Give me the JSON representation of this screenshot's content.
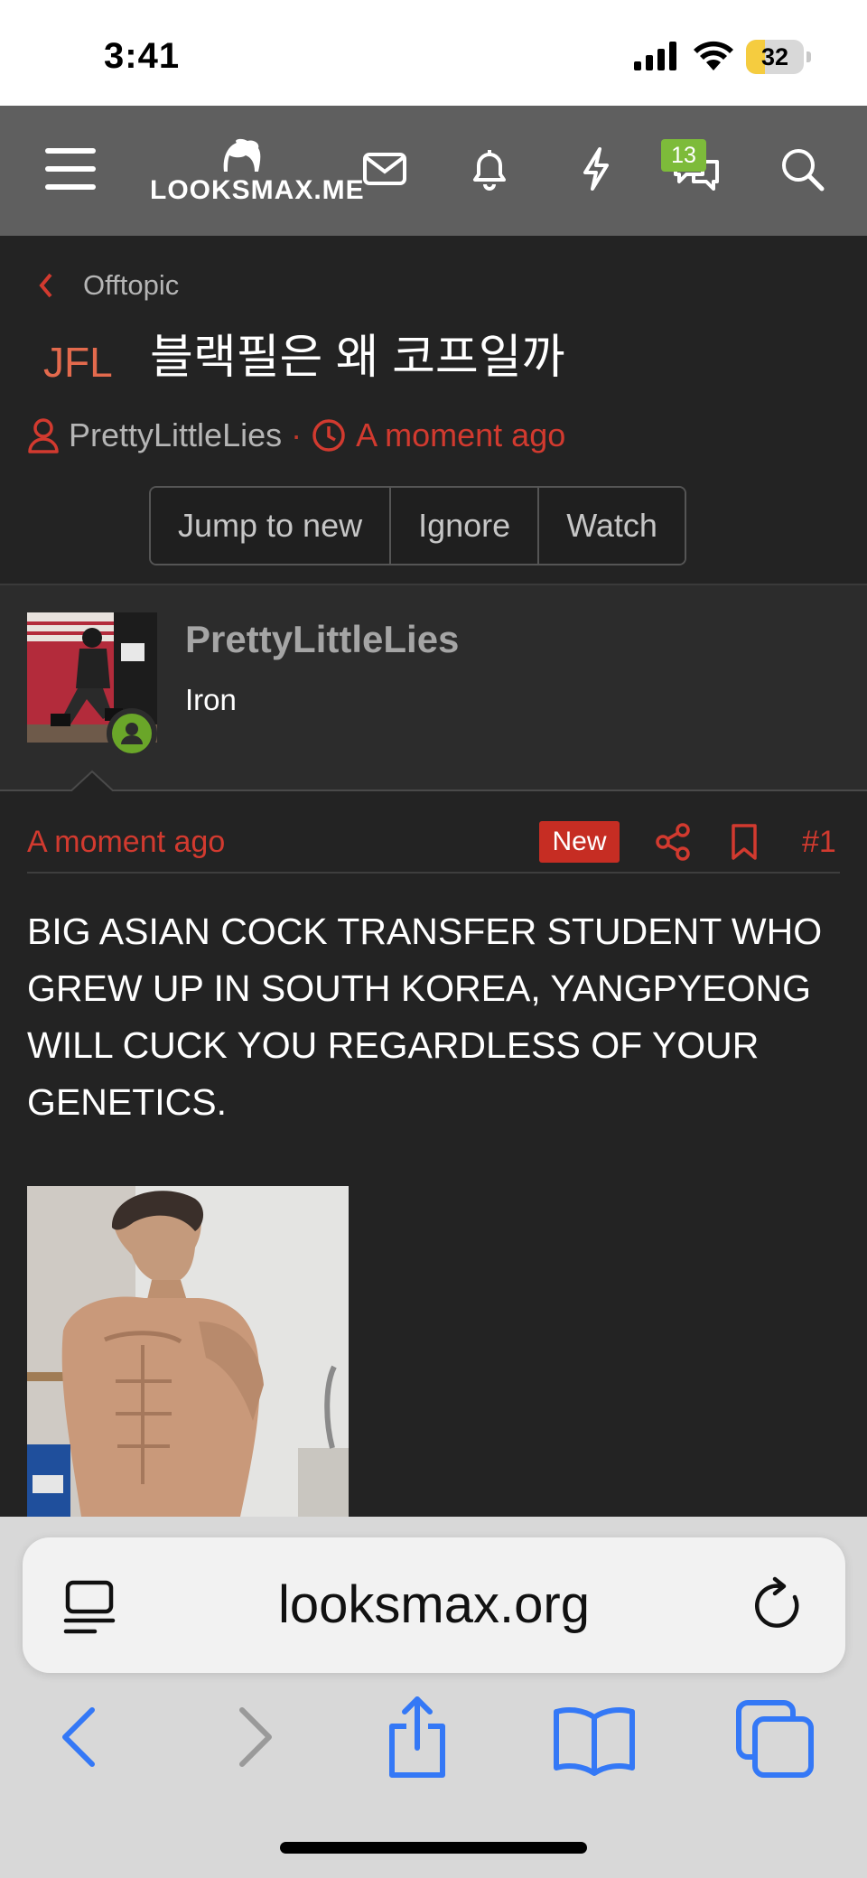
{
  "status_bar": {
    "time": "3:41",
    "battery": "32"
  },
  "header": {
    "logo": "LOOKSMAX.ME",
    "messages_badge": "13"
  },
  "thread": {
    "breadcrumb": "Offtopic",
    "prefix": "JFL",
    "title": "블랙필은 왜 코프일까",
    "author": "PrettyLittleLies",
    "meta_separator": "·",
    "time": "A moment ago",
    "buttons": {
      "jump": "Jump to new",
      "ignore": "Ignore",
      "watch": "Watch"
    }
  },
  "post": {
    "author": "PrettyLittleLies",
    "user_title": "Iron",
    "time": "A moment ago",
    "new_badge": "New",
    "number": "#1",
    "body": "BIG ASIAN COCK TRANSFER STUDENT WHO GREW UP IN SOUTH KOREA, YANGPYEONG WILL CUCK YOU REGARDLESS OF YOUR GENETICS."
  },
  "browser": {
    "url": "looksmax.org"
  },
  "colors": {
    "accent_red": "#d23a2f",
    "header_bg": "#5f5f5f",
    "page_bg": "#232323",
    "online_green": "#6aa629",
    "badge_green": "#7dbb3a",
    "safari_blue": "#3478f6"
  }
}
